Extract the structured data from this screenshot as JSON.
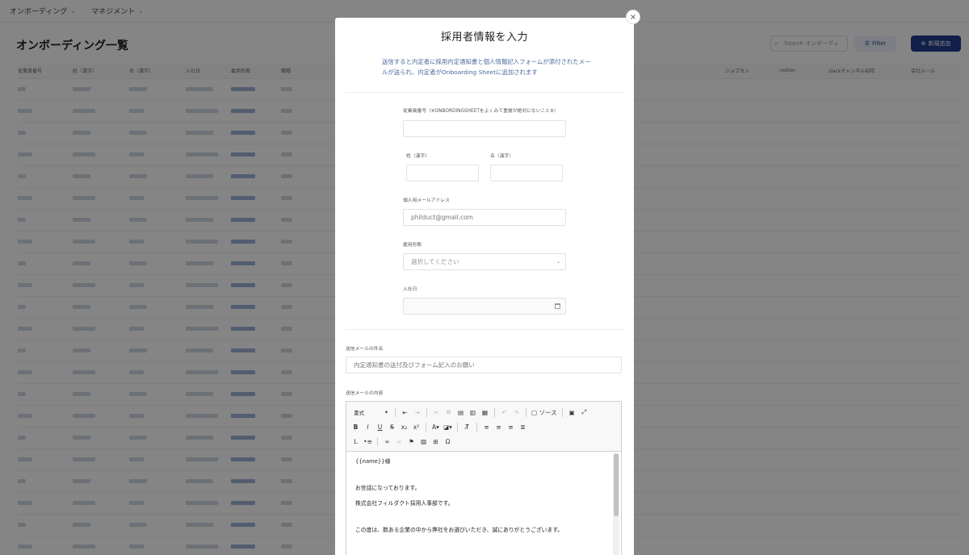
{
  "nav": {
    "items": [
      "オンボーディング",
      "マネジメント"
    ]
  },
  "page": {
    "title": "オンボーディング一覧",
    "search_placeholder": "Search オンボーディ",
    "filter_label": "Filter",
    "add_label": "新規追加"
  },
  "table": {
    "headers": [
      "従業員番号",
      "姓（漢字）",
      "名（漢字）",
      "入社日",
      "雇用形態",
      "職種"
    ],
    "headers_right": [
      "ジョブカン",
      "notion",
      "slackチャンネル招待",
      "会社ルール"
    ],
    "row_count": 22
  },
  "modal": {
    "title": "採用者情報を入力",
    "description": "送信すると内定者に採用内定通知書と個人情報記入フォームが添付されたメールが送られ、内定者がOnboarding Sheetに追加されます",
    "close_icon": "×",
    "fields": {
      "employee_no_label": "従業員番号（※ONBORDINGSHEETをよくみて重複が絶対にないこと※）",
      "employee_no_value": "",
      "last_name_label": "姓（漢字）",
      "last_name_value": "",
      "first_name_label": "名（漢字）",
      "first_name_value": "",
      "email_label": "個人用メールアドレス",
      "email_value": "philduct@gmail.com",
      "employment_label": "雇用形態",
      "employment_value": "選択してください",
      "start_date_label": "入社日",
      "start_date_value": "",
      "subject_label": "送信メールの件名",
      "subject_value": "内定通知書の送付及びフォーム記入のお願い",
      "body_label": "送信メールの内容"
    },
    "editor": {
      "format_label": "書式",
      "source_label": "ソース",
      "lines": [
        "{{name}}様",
        "お世話になっております。",
        "株式会社フィルダクト採用人事部です。",
        "この度は、数ある企業の中から弊社をお選びいただき、誠にありがとうございます。"
      ]
    }
  }
}
